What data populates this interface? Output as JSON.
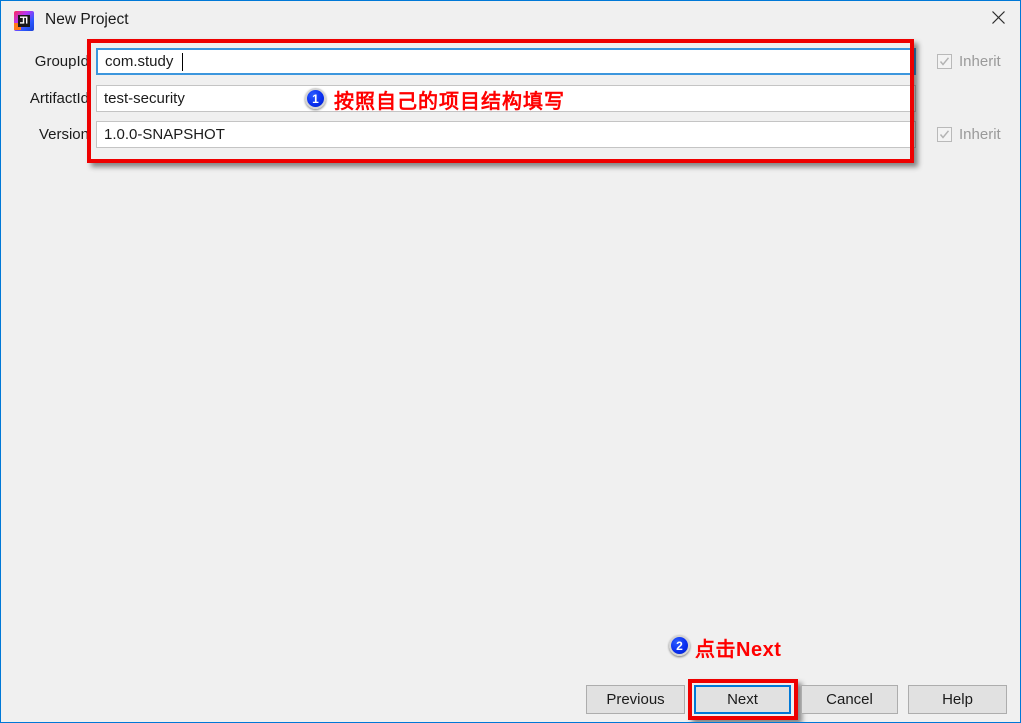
{
  "window": {
    "title": "New Project",
    "app_icon": "intellij-idea-icon",
    "close_icon": "close-icon",
    "border_color": "#0078d7",
    "background": "#f0f0f0"
  },
  "form": {
    "rows": [
      {
        "label": "GroupId",
        "value": "com.study",
        "focused": true,
        "inherit": {
          "label": "Inherit",
          "checked": true,
          "enabled": false
        }
      },
      {
        "label": "ArtifactId",
        "value": "test-security",
        "focused": false,
        "inherit": null
      },
      {
        "label": "Version",
        "value": "1.0.0-SNAPSHOT",
        "focused": false,
        "inherit": {
          "label": "Inherit",
          "checked": true,
          "enabled": false
        }
      }
    ]
  },
  "annotations": {
    "color": "#ff0000",
    "items": [
      {
        "badge": "1",
        "text": "按照自己的项目结构填写"
      },
      {
        "badge": "2",
        "text": "点击Next"
      }
    ]
  },
  "buttons": {
    "previous": "Previous",
    "next": "Next",
    "cancel": "Cancel",
    "help": "Help",
    "default_button": "Next"
  }
}
